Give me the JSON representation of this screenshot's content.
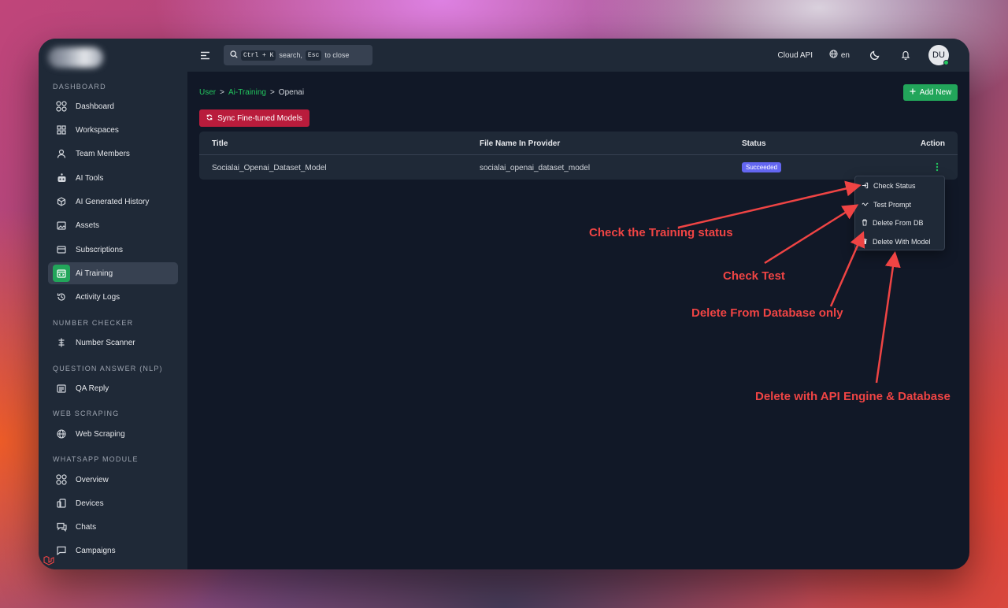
{
  "sidebar": {
    "sections": {
      "dashboard": "DASHBOARD",
      "number_checker": "NUMBER CHECKER",
      "qa": "QUESTION ANSWER (NLP)",
      "web_scraping": "WEB SCRAPING",
      "whatsapp": "WHATSAPP MODULE"
    },
    "items": {
      "dashboard": "Dashboard",
      "workspaces": "Workspaces",
      "team_members": "Team Members",
      "ai_tools": "AI Tools",
      "ai_history": "AI Generated History",
      "assets": "Assets",
      "subscriptions": "Subscriptions",
      "ai_training": "Ai Training",
      "activity_logs": "Activity Logs",
      "number_scanner": "Number Scanner",
      "qa_reply": "QA Reply",
      "web_scraping": "Web Scraping",
      "overview": "Overview",
      "devices": "Devices",
      "chats": "Chats",
      "campaigns": "Campaigns"
    },
    "active": "ai_training"
  },
  "topbar": {
    "search_kbd_1": "Ctrl + K",
    "search_text_1": "search,",
    "search_kbd_2": "Esc",
    "search_text_2": "to close",
    "cloud_api": "Cloud API",
    "language": "en",
    "avatar_initials": "DU"
  },
  "breadcrumb": {
    "items": [
      "User",
      "Ai-Training",
      "Openai"
    ],
    "separator": ">"
  },
  "buttons": {
    "add_new": "Add New",
    "sync": "Sync Fine-tuned Models"
  },
  "table": {
    "headers": [
      "Title",
      "File Name In Provider",
      "Status",
      "Action"
    ],
    "rows": [
      {
        "title": "Socialai_Openai_Dataset_Model",
        "file_name": "socialai_openai_dataset_model",
        "status": "Succeeded"
      }
    ]
  },
  "dropdown": {
    "items": [
      "Check Status",
      "Test Prompt",
      "Delete From DB",
      "Delete With Model"
    ]
  },
  "annotations": {
    "check_training": "Check the Training status",
    "check_test": "Check Test",
    "delete_db": "Delete From Database only",
    "delete_model": "Delete with API Engine & Database"
  },
  "colors": {
    "accent_green": "#22a55a",
    "sync_red": "#b91c3c",
    "status_badge": "#6366f1",
    "annotation_red": "#ef4444"
  }
}
